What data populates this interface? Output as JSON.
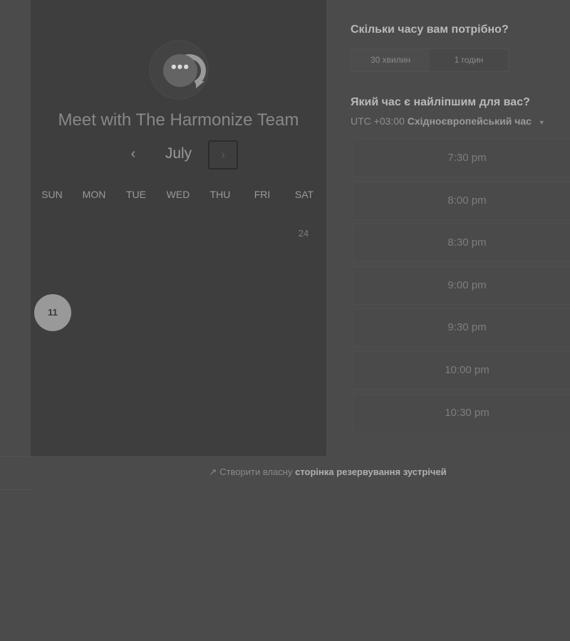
{
  "calendar": {
    "title": "Meet with The Harmonize Team",
    "month": "July",
    "prev_icon": "‹",
    "next_icon": "›",
    "weekdays": [
      "SUN",
      "MON",
      "TUE",
      "WED",
      "THU",
      "FRI",
      "SAT"
    ],
    "visible_dates": [
      "24",
      "11"
    ],
    "selected_date": "11"
  },
  "booking": {
    "duration_question": "Скільки часу вам потрібно?",
    "duration_options": [
      "30 хвилин",
      "1 годин"
    ],
    "selected_duration": "30 хвилин",
    "time_question": "Який час є найліпшим для вас?",
    "timezone_offset": "UTC +03:00",
    "timezone_name": "Східноєвропейський час",
    "time_slots": [
      "7:30 pm",
      "8:00 pm",
      "8:30 pm",
      "9:00 pm",
      "9:30 pm",
      "10:00 pm",
      "10:30 pm"
    ]
  },
  "footer": {
    "prefix": "Створити власну",
    "link": "сторінка резервування зустрічей"
  },
  "colors": {
    "background": "#4b4b4b",
    "panel": "#3e3e3e",
    "selected_day": "#999999"
  },
  "icons": {
    "logo": "chat-bubble-logo-icon",
    "prev": "chevron-left-icon",
    "next": "chevron-right-icon",
    "timezone_caret": "caret-down-icon",
    "footer": "external-arrow-icon"
  }
}
